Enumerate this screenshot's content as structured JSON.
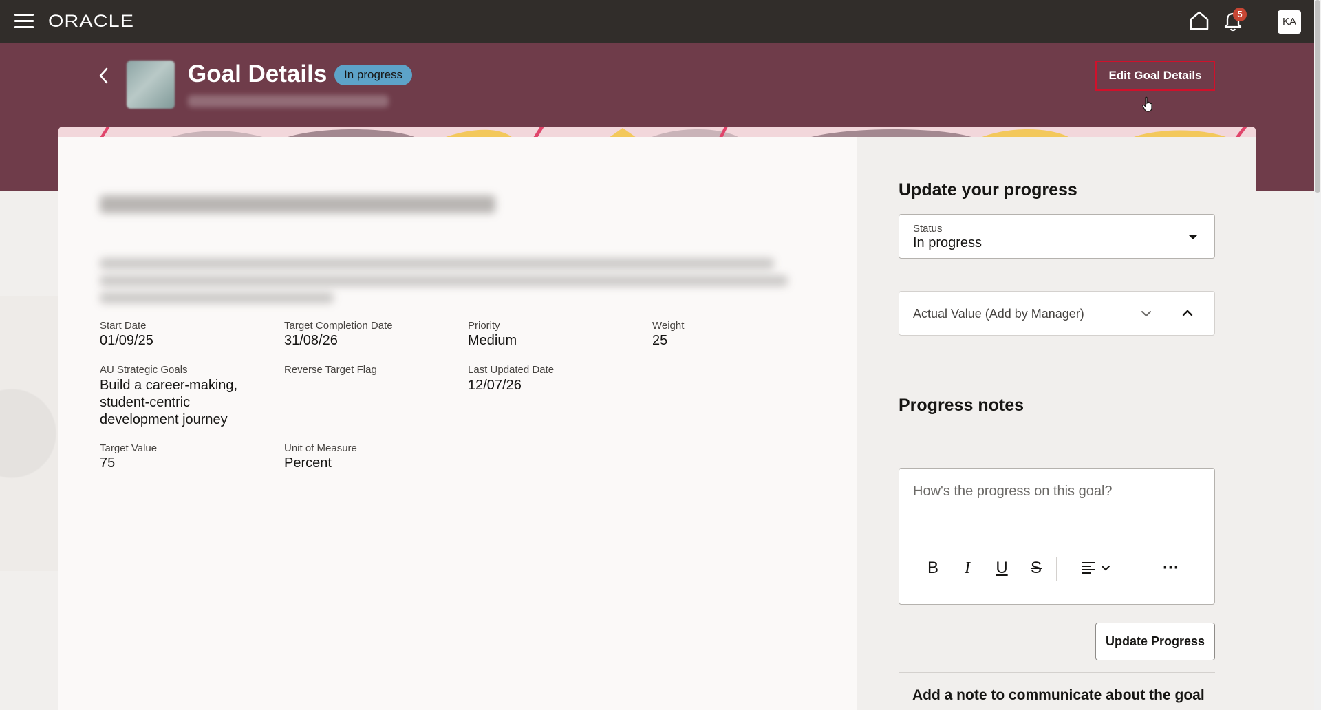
{
  "topbar": {
    "logo": "ORACLE",
    "notification_count": "5",
    "avatar_initials": "KA"
  },
  "header": {
    "title": "Goal Details",
    "status": "In progress",
    "edit_button": "Edit Goal Details"
  },
  "details": {
    "fields": [
      {
        "label": "Start Date",
        "value": "01/09/25"
      },
      {
        "label": "Target Completion Date",
        "value": "31/08/26"
      },
      {
        "label": "Priority",
        "value": "Medium"
      },
      {
        "label": "Weight",
        "value": "25"
      },
      {
        "label": "AU Strategic Goals",
        "value_lines": [
          "Build a career-making,",
          "student-centric",
          "development journey"
        ]
      },
      {
        "label": "Reverse Target Flag",
        "value": ""
      },
      {
        "label": "Last Updated Date",
        "value": "12/07/26"
      },
      {
        "label": "Target Value",
        "value": "75"
      },
      {
        "label": "Unit of Measure",
        "value": "Percent"
      }
    ]
  },
  "progress_panel": {
    "title": "Update your progress",
    "status_label": "Status",
    "status_value": "In progress",
    "actual_value_label": "Actual Value (Add by Manager)",
    "notes_title": "Progress notes",
    "notes_placeholder": "How's the progress on this goal?",
    "toolbar": {
      "bold": "B",
      "italic": "I",
      "underline": "U",
      "strike": "S",
      "more": "···"
    },
    "update_button": "Update Progress",
    "add_note_heading": "Add a note to communicate about the goal"
  }
}
